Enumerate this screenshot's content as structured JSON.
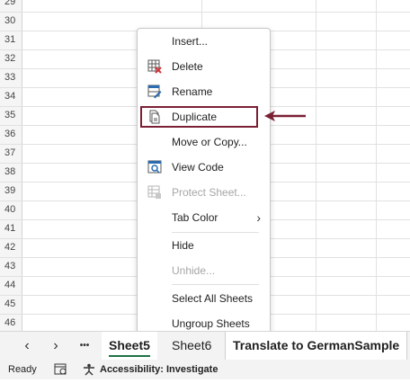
{
  "grid": {
    "row_numbers": [
      "29",
      "30",
      "31",
      "32",
      "33",
      "34",
      "35",
      "36",
      "37",
      "38",
      "39",
      "40",
      "41",
      "42",
      "43",
      "44",
      "45",
      "46"
    ]
  },
  "context_menu": {
    "items": [
      {
        "label": "Insert...",
        "mnemonic": "I",
        "icon": "none",
        "enabled": true
      },
      {
        "label": "Delete",
        "mnemonic": "D",
        "icon": "delete-sheet-icon",
        "enabled": true
      },
      {
        "label": "Rename",
        "mnemonic": "R",
        "icon": "rename-sheet-icon",
        "enabled": true
      },
      {
        "label": "Duplicate",
        "mnemonic": "D",
        "icon": "duplicate-icon",
        "enabled": true
      },
      {
        "label": "Move or Copy...",
        "mnemonic": "M",
        "icon": "none",
        "enabled": true
      },
      {
        "label": "View Code",
        "mnemonic": "V",
        "icon": "view-code-icon",
        "enabled": true
      },
      {
        "label": "Protect Sheet...",
        "mnemonic": "P",
        "icon": "protect-sheet-icon",
        "enabled": false
      },
      {
        "label": "Tab Color",
        "mnemonic": "T",
        "icon": "none",
        "enabled": true,
        "submenu": true
      },
      {
        "label": "Hide",
        "mnemonic": "H",
        "icon": "none",
        "enabled": true
      },
      {
        "label": "Unhide...",
        "mnemonic": "U",
        "icon": "none",
        "enabled": false
      },
      {
        "label": "Select All Sheets",
        "mnemonic": "S",
        "icon": "none",
        "enabled": true
      },
      {
        "label": "Ungroup Sheets",
        "mnemonic": "U",
        "icon": "none",
        "enabled": true
      }
    ],
    "submenu_glyph": "›"
  },
  "annotation": {
    "highlighted_item": "Duplicate",
    "color": "#7b1f34"
  },
  "sheet_bar": {
    "prev_glyph": "‹",
    "next_glyph": "›",
    "more_glyph": "•••",
    "tabs": [
      {
        "label": "Sheet5",
        "active": true
      },
      {
        "label": "Sheet6",
        "active": false
      },
      {
        "label": "Translate to GermanSample",
        "active": false
      }
    ],
    "active_color": "#1e7145"
  },
  "status_bar": {
    "mode": "Ready",
    "accessibility": "Accessibility: Investigate"
  }
}
